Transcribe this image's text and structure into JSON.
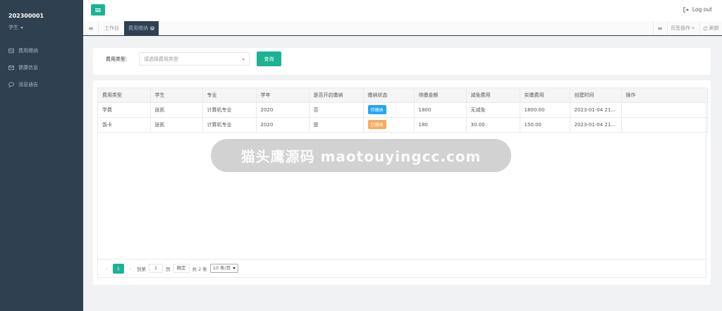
{
  "sidebar": {
    "user_id": "202300001",
    "user_role": "学生",
    "items": [
      {
        "label": "费用缴纳",
        "icon": "id-card-icon"
      },
      {
        "label": "健康信息",
        "icon": "envelope-icon"
      },
      {
        "label": "消息通告",
        "icon": "comment-icon"
      }
    ]
  },
  "header": {
    "logout_label": "Log out"
  },
  "tabs": {
    "home_label": "工作台",
    "active_label": "费用缴纳",
    "page_ops_label": "页签操作",
    "refresh_label": "刷新"
  },
  "search": {
    "type_label": "费用类型:",
    "type_placeholder": "请选择费用类型",
    "query_label": "查询"
  },
  "table": {
    "columns": [
      "费用类型",
      "学生",
      "专业",
      "学年",
      "是否开启缴纳",
      "缴纳状态",
      "待缴金额",
      "减免费用",
      "实缴费用",
      "创建时间",
      "操作"
    ],
    "rows": [
      {
        "fee_type": "学费",
        "student": "张凯",
        "major": "计算机专业",
        "year": "2020",
        "enabled": "否",
        "status": "待缴纳",
        "status_color": "#23a7f2",
        "due": "1800",
        "waiver": "无减免",
        "paid": "1800.00",
        "created": "2023-01-04 21...",
        "ops": ""
      },
      {
        "fee_type": "饭卡",
        "student": "张凯",
        "major": "计算机专业",
        "year": "2020",
        "enabled": "是",
        "status": "已缴纳",
        "status_color": "#f8ac59",
        "due": "180",
        "waiver": "30.00",
        "paid": "150.00",
        "created": "2023-01-04 21...",
        "ops": ""
      }
    ]
  },
  "pagination": {
    "current_page": "1",
    "goto_label": "到第",
    "goto_value": "1",
    "page_unit": "页",
    "confirm_label": "确定",
    "total_label": "共 2 条",
    "page_size": "10 条/页"
  },
  "watermark": {
    "text": "猫头鹰源码 maotouyingcc.com"
  },
  "colors": {
    "sidebar_bg": "#2f4050",
    "accent": "#1ab394",
    "pending": "#23a7f2",
    "paid": "#f8ac59"
  }
}
